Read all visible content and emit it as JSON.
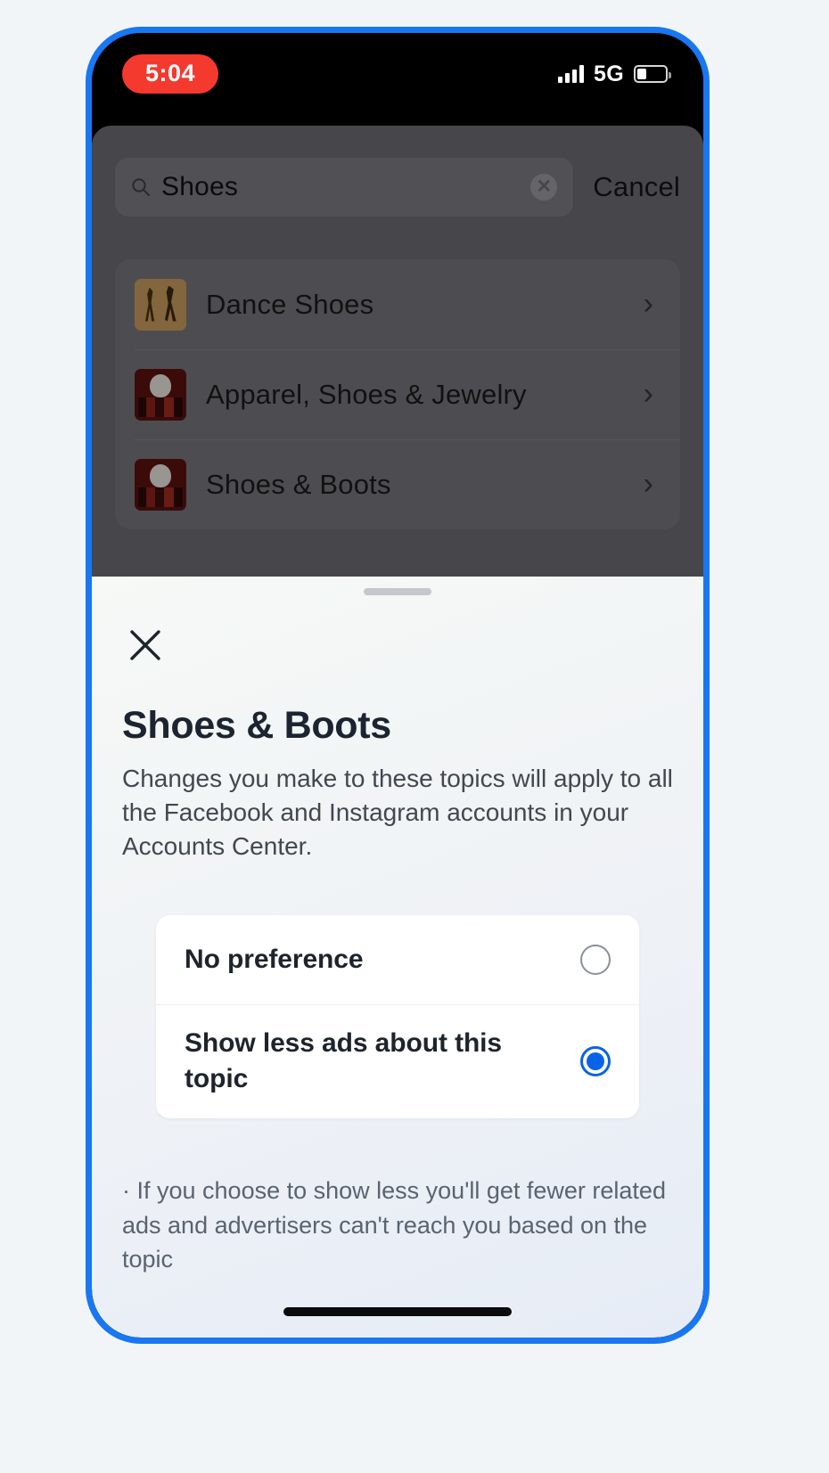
{
  "status_bar": {
    "time": "5:04",
    "network": "5G",
    "signal_icon": "signal-bars-icon",
    "battery_icon": "battery-icon",
    "battery_level_pct": 32,
    "time_pill_color": "#f4392f"
  },
  "background_app": {
    "search": {
      "value": "Shoes",
      "placeholder": "Search",
      "search_icon": "search-icon",
      "clear_icon": "clear-circle-icon",
      "cancel_label": "Cancel"
    },
    "results": [
      {
        "label": "Dance Shoes",
        "thumb": "dance-shoes-thumbnail",
        "chevron": "chevron-right-icon"
      },
      {
        "label": "Apparel, Shoes & Jewelry",
        "thumb": "apparel-thumbnail",
        "chevron": "chevron-right-icon"
      },
      {
        "label": "Shoes & Boots",
        "thumb": "shoes-boots-thumbnail",
        "chevron": "chevron-right-icon"
      }
    ]
  },
  "sheet": {
    "grabber": "drag-handle",
    "close_icon": "close-x-icon",
    "title": "Shoes & Boots",
    "description": "Changes you make to these topics will apply to all the Facebook and Instagram accounts in your Accounts Center.",
    "options": [
      {
        "label": "No preference",
        "selected": false
      },
      {
        "label": "Show less ads about this topic",
        "selected": true
      }
    ],
    "footnote": "· If you choose to show less you'll get fewer related ads and advertisers can't reach you based on the topic",
    "selected_accent_color": "#0a62e8"
  },
  "device": {
    "frame_color": "#1877f2",
    "home_indicator": "home-indicator"
  }
}
